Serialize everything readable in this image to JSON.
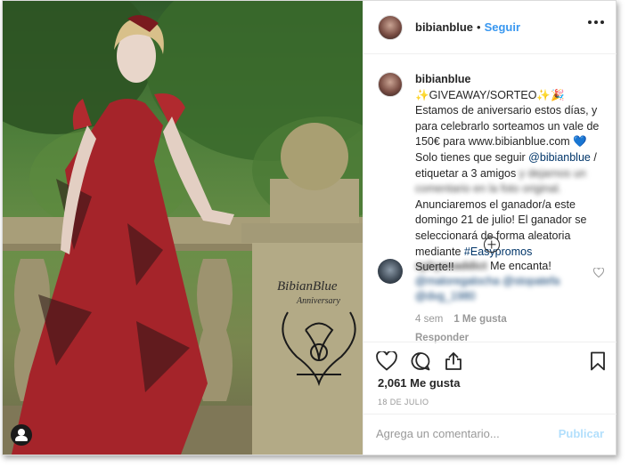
{
  "post": {
    "username": "bibianblue",
    "follow_label": "Seguir",
    "separator": "•",
    "more_icon": "more-horizontal-icon"
  },
  "photo": {
    "watermark_line1": "BibianBlue",
    "watermark_line2": "Anniversary",
    "user_tag_icon": "user-tag-icon"
  },
  "caption": {
    "username": "bibianblue",
    "line_title": "✨GIVEAWAY/SORTEO✨🎉",
    "text_1": "Estamos de aniversario estos días, y para celebrarlo sorteamos un vale de 150€ para www.bibianblue.com 💙 Solo tienes que seguir ",
    "mention": "@bibianblue",
    "text_2": " / etiquetar a 3 amigos ",
    "blurred_text": "y dejarnos un comentario en la foto original.",
    "text_3": " Anunciaremos el ganador/a este domingo 21 de julio! El ganador se seleccionará de forma aleatoria mediante ",
    "hashtag": "#Easypromos",
    "text_4": " Suerte!!"
  },
  "comment": {
    "username": "sphynxaddict",
    "text": "Me encanta!",
    "mentions_blurred": "@maloregalocha @stopatefa @dvg_1980",
    "age": "4 sem",
    "likes": "1 Me gusta",
    "reply_label": "Responder"
  },
  "actions": {
    "likes_count": "2,061 Me gusta",
    "date": "18 DE JULIO"
  },
  "add_comment": {
    "placeholder": "Agrega un comentario...",
    "publish_label": "Publicar"
  },
  "colors": {
    "accent": "#3897f0",
    "publish_disabled": "#b2dffc",
    "muted": "#999999",
    "text": "#262626"
  }
}
